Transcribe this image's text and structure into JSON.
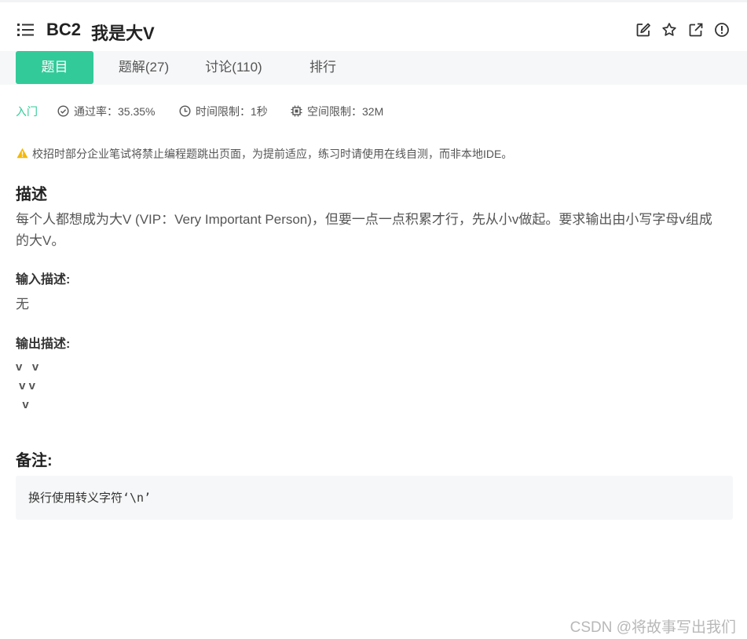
{
  "header": {
    "code": "BC2",
    "name": "我是大V",
    "icons": [
      "list-icon",
      "edit-icon",
      "star-icon",
      "share-icon",
      "report-icon"
    ]
  },
  "tabs": [
    {
      "label": "题目",
      "active": true
    },
    {
      "label": "题解(27)",
      "active": false
    },
    {
      "label": "讨论(110)",
      "active": false
    },
    {
      "label": "排行",
      "active": false
    }
  ],
  "meta": {
    "level": "入门",
    "pass_rate": "通过率：35.35%",
    "time_limit": "时间限制：1秒",
    "space_limit": "空间限制：32M"
  },
  "warning": "校招时部分企业笔试将禁止编程题跳出页面，为提前适应，练习时请使用在线自测，而非本地IDE。",
  "description": {
    "heading": "描述",
    "line1": "每个人都想成为大V (VIP：Very Important Person)，但要一点一点积累才行，先从小v做起。要求输出由小写字母v组成",
    "line2": "的大V。"
  },
  "input": {
    "heading": "输入描述:",
    "text": "无"
  },
  "output": {
    "heading": "输出描述:",
    "lines": [
      "v   v",
      " v v",
      "  v"
    ]
  },
  "note": {
    "heading": "备注:",
    "text": "换行使用转义字符‘\\n’"
  },
  "watermark": "CSDN @将故事写出我们",
  "colors": {
    "accent": "#32ca99",
    "warning": "#f5b800",
    "tab_bar": "#f6f7f8"
  }
}
